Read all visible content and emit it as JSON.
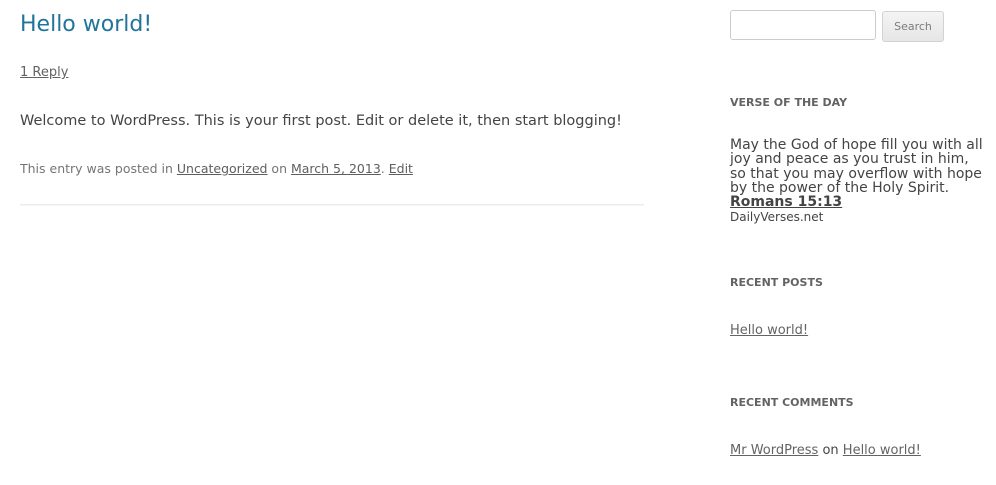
{
  "post": {
    "title": "Hello world!",
    "reply_link": "1 Reply",
    "content": "Welcome to WordPress. This is your first post. Edit or delete it, then start blogging!",
    "meta": {
      "prefix": "This entry was posted in ",
      "category": "Uncategorized",
      "on_text": " on ",
      "date": "March 5, 2013",
      "separator": ". ",
      "edit": "Edit"
    }
  },
  "sidebar": {
    "search": {
      "value": "",
      "placeholder": "",
      "button_label": "Search"
    },
    "verse_widget": {
      "title": "VERSE OF THE DAY",
      "text": "May the God of hope fill you with all joy and peace as you trust in him, so that you may overflow with hope by the power of the Holy Spirit.",
      "reference": "Romans 15:13",
      "source": "DailyVerses.net"
    },
    "recent_posts": {
      "title": "RECENT POSTS",
      "items": [
        {
          "label": "Hello world!"
        }
      ]
    },
    "recent_comments": {
      "title": "RECENT COMMENTS",
      "items": [
        {
          "author": "Mr WordPress",
          "on_text": " on ",
          "post": "Hello world!"
        }
      ]
    }
  },
  "colors": {
    "title_link": "#21759b",
    "body_text": "#444444",
    "meta_text": "#757575"
  }
}
